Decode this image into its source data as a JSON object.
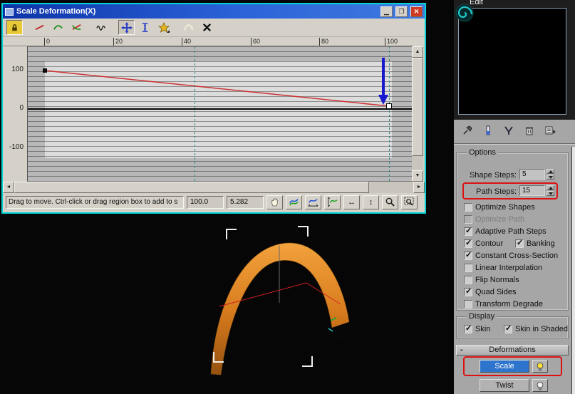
{
  "window": {
    "title": "Scale Deformation(X)",
    "controls": [
      "minimize",
      "maximize",
      "close"
    ],
    "toolbar_icons": [
      "make-symmetrical",
      "display-x-axis",
      "display-y-axis",
      "display-xy-axes",
      "swap-deform-curves",
      "move-control-point",
      "scale-control-point",
      "insert-corner-point",
      "reset-curve",
      "delete-control-point"
    ],
    "ruler": [
      "0",
      "20",
      "40",
      "60",
      "80",
      "100"
    ],
    "y_axis": [
      "100",
      "0",
      "-100"
    ],
    "graph": {
      "curve_points": [
        [
          0,
          100
        ],
        [
          100,
          5.282
        ]
      ],
      "selected_point": {
        "x": "100.0",
        "y": "5.282"
      }
    },
    "status": {
      "prompt": "Drag to move. Ctrl-click or drag region box to add to s",
      "x_value": "100.0",
      "y_value": "5.282",
      "nav_icons": [
        "pan",
        "zoom-extents",
        "zoom-horizontal-extents",
        "zoom-vertical-extents",
        "zoom-horizontally",
        "zoom-vertically",
        "zoom",
        "zoom-region"
      ]
    }
  },
  "panel": {
    "edit_label": "Edit",
    "stack_icons": [
      "pin-stack",
      "show-end-result",
      "make-unique",
      "remove-modifier",
      "configure-modifier-sets"
    ],
    "options": {
      "title": "Options",
      "shape_steps": {
        "label": "Shape Steps:",
        "value": "5"
      },
      "path_steps": {
        "label": "Path Steps:",
        "value": "15"
      },
      "checkboxes": [
        {
          "label": "Optimize Shapes",
          "checked": false,
          "disabled": false
        },
        {
          "label": "Optimize Path",
          "checked": false,
          "disabled": true
        },
        {
          "label": "Adaptive Path Steps",
          "checked": true,
          "disabled": false
        },
        {
          "label": "Contour",
          "checked": true,
          "disabled": false
        },
        {
          "label": "Banking",
          "checked": true,
          "disabled": false
        },
        {
          "label": "Constant Cross-Section",
          "checked": true,
          "disabled": false
        },
        {
          "label": "Linear Interpolation",
          "checked": false,
          "disabled": false
        },
        {
          "label": "Flip Normals",
          "checked": false,
          "disabled": false
        },
        {
          "label": "Quad Sides",
          "checked": true,
          "disabled": false
        },
        {
          "label": "Transform Degrade",
          "checked": false,
          "disabled": false
        }
      ]
    },
    "display": {
      "title": "Display",
      "skin": {
        "label": "Skin",
        "checked": true
      },
      "skin_in_shaded": {
        "label": "Skin in Shaded",
        "checked": true
      }
    },
    "deformations": {
      "title": "Deformations",
      "collapse_glyph": "-",
      "scale_button": "Scale",
      "twist_button": "Twist"
    }
  },
  "colors": {
    "dialog_border_cyan": "#00d4d4",
    "titlebar_blue": "#2b62d8",
    "annotation_red": "#dd1111",
    "arrow_blue": "#1818cc",
    "curve_red": "#cc3333",
    "arch_orange": "#d97d1f",
    "scale_button_blue": "#2d74cc"
  }
}
